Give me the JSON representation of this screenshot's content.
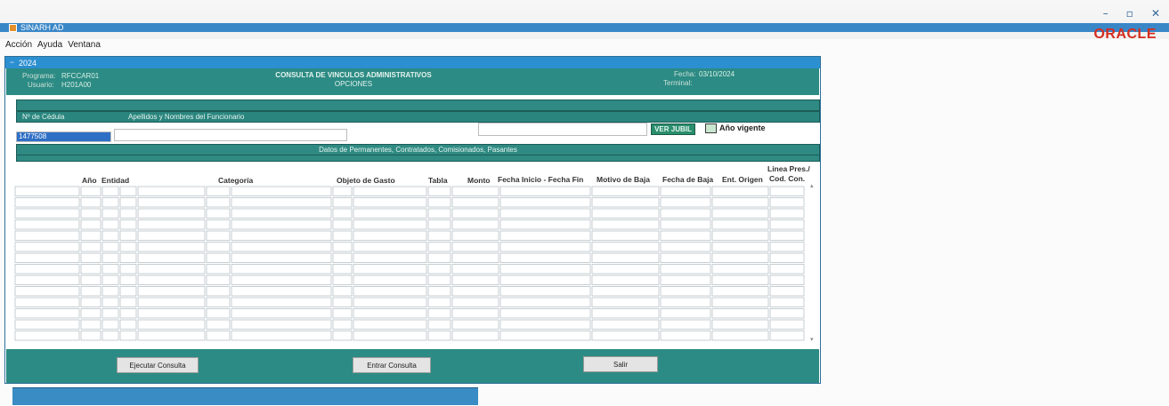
{
  "window": {
    "title": "SINARH AD",
    "brand": "ORACLE",
    "controls": [
      "–",
      "▫",
      "✕"
    ]
  },
  "menu": [
    "Acción",
    "Ayuda",
    "Ventana"
  ],
  "frame": {
    "title": "2024",
    "header": {
      "programa_label": "Programa:",
      "programa_value": "RFCCAR01",
      "usuario_label": "Usuario:",
      "usuario_value": "H201A00",
      "title_line1": "CONSULTA DE VINCULOS ADMINISTRATIVOS",
      "title_line2": "OPCIONES",
      "fecha_label": "Fecha:",
      "fecha_value": "03/10/2024",
      "terminal_label": "Terminal:"
    },
    "search": {
      "cedula_label": "Nº de Cédula",
      "nombre_label": "Apellidos y Nombres del Funcionario",
      "cedula_value": "1477508",
      "ver_jubil_label": "VER JUBIL",
      "anio_vigente_label": "Año vigente"
    },
    "datos_label": "Datos de Permanentes, Contratados, Comisionados, Pasantes",
    "columns": [
      "Año",
      "Entidad",
      "Categoría",
      "Objeto de Gasto",
      "Tabla",
      "Monto",
      "Fecha Inicio - Fecha Fin",
      "Motivo de Baja",
      "Fecha de Baja",
      "Ent. Origen",
      "Linea Pres./",
      "Cod. Con."
    ],
    "buttons": {
      "ejecutar": "Ejecutar Consulta",
      "entrar": "Entrar Consulta",
      "salir": "Salir"
    }
  },
  "colors": {
    "teal": "#2c8b84",
    "title_blue": "#2c8fd0",
    "oracle_red": "#d42d1f"
  }
}
